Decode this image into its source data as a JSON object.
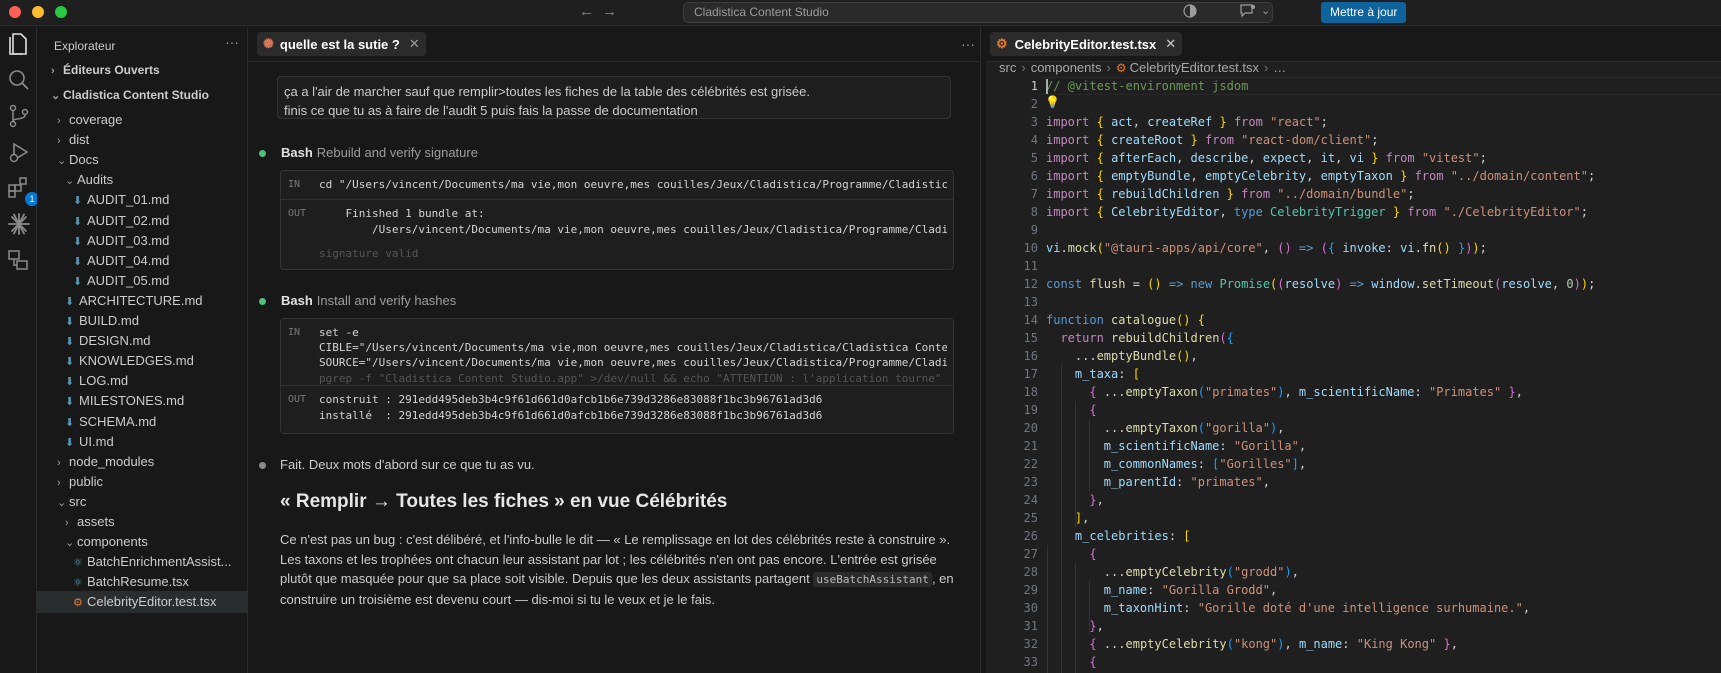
{
  "titlebar": {
    "command_center": "Cladistica Content Studio",
    "update_button": "Mettre à jour"
  },
  "activity_badge": "1",
  "explorer": {
    "title": "Explorateur",
    "open_editors": "Éditeurs Ouverts",
    "project": "Cladistica Content Studio",
    "items": [
      {
        "label": "coverage",
        "kind": "folder",
        "depth": 1,
        "expanded": false
      },
      {
        "label": "dist",
        "kind": "folder",
        "depth": 1,
        "expanded": false
      },
      {
        "label": "Docs",
        "kind": "folder",
        "depth": 1,
        "expanded": true
      },
      {
        "label": "Audits",
        "kind": "folder",
        "depth": 2,
        "expanded": true
      },
      {
        "label": "AUDIT_01.md",
        "kind": "md",
        "depth": 3
      },
      {
        "label": "AUDIT_02.md",
        "kind": "md",
        "depth": 3
      },
      {
        "label": "AUDIT_03.md",
        "kind": "md",
        "depth": 3
      },
      {
        "label": "AUDIT_04.md",
        "kind": "md",
        "depth": 3
      },
      {
        "label": "AUDIT_05.md",
        "kind": "md",
        "depth": 3
      },
      {
        "label": "ARCHITECTURE.md",
        "kind": "md",
        "depth": 2
      },
      {
        "label": "BUILD.md",
        "kind": "md",
        "depth": 2
      },
      {
        "label": "DESIGN.md",
        "kind": "md",
        "depth": 2
      },
      {
        "label": "KNOWLEDGES.md",
        "kind": "md",
        "depth": 2
      },
      {
        "label": "LOG.md",
        "kind": "md",
        "depth": 2
      },
      {
        "label": "MILESTONES.md",
        "kind": "md",
        "depth": 2
      },
      {
        "label": "SCHEMA.md",
        "kind": "md",
        "depth": 2
      },
      {
        "label": "UI.md",
        "kind": "md",
        "depth": 2
      },
      {
        "label": "node_modules",
        "kind": "folder",
        "depth": 1,
        "expanded": false
      },
      {
        "label": "public",
        "kind": "folder",
        "depth": 1,
        "expanded": false
      },
      {
        "label": "src",
        "kind": "folder",
        "depth": 1,
        "expanded": true
      },
      {
        "label": "assets",
        "kind": "folder",
        "depth": 2,
        "expanded": false
      },
      {
        "label": "components",
        "kind": "folder",
        "depth": 2,
        "expanded": true
      },
      {
        "label": "BatchEnrichmentAssist...",
        "kind": "tsx",
        "depth": 3
      },
      {
        "label": "BatchResume.tsx",
        "kind": "tsx",
        "depth": 3
      },
      {
        "label": "CelebrityEditor.test.tsx",
        "kind": "tsx-test",
        "depth": 3,
        "active": true
      }
    ]
  },
  "chat": {
    "tab_label": "quelle est la sutie ?",
    "user_message_line1": "ça a l'air de marcher sauf que remplir>toutes les fiches de la table des célébrités est grisée.",
    "user_message_line2": "finis ce que tu as à faire de l'audit 5 puis fais la passe de documentation",
    "step1": {
      "tool": "Bash",
      "desc": "Rebuild and verify signature",
      "in_label": "IN",
      "in_code": "cd \"/Users/vincent/Documents/ma vie,mon oeuvre,mes couilles/Jeux/Cladistica/Programme/Cladistica Content Studio\"",
      "out_label": "OUT",
      "out_line1": "    Finished 1 bundle at:",
      "out_line2": "        /Users/vincent/Documents/ma vie,mon oeuvre,mes couilles/Jeux/Cladistica/Programme/Cladistica Content Studio",
      "out_line3": "signature valid"
    },
    "step2": {
      "tool": "Bash",
      "desc": "Install and verify hashes",
      "in_label": "IN",
      "in_line1": "set -e",
      "in_line2": "CIBLE=\"/Users/vincent/Documents/ma vie,mon oeuvre,mes couilles/Jeux/Cladistica/Cladistica Content Studio\"",
      "in_line3": "SOURCE=\"/Users/vincent/Documents/ma vie,mon oeuvre,mes couilles/Jeux/Cladistica/Programme/Cladistica Content Studio\"",
      "in_line4": "pgrep -f \"Cladistica Content Studio.app\" >/dev/null && echo \"ATTENTION : l'application tourne\" || true",
      "out_label": "OUT",
      "out_line1": "construit : 291edd495deb3b4c9f61d661d0afcb1b6e739d3286e83088f1bc3b96761ad3d6",
      "out_line2": "installé  : 291edd495deb3b4c9f61d661d0afcb1b6e739d3286e83088f1bc3b96761ad3d6"
    },
    "answer_intro": "Fait. Deux mots d'abord sur ce que tu as vu.",
    "answer_heading": "« Remplir → Toutes les fiches » en vue Célébrités",
    "answer_para_1": "Ce n'est pas un bug : c'est délibéré, et l'info-bulle le dit — « Le remplissage en lot des célébrités reste à construire ». Les taxons et les trophées ont chacun leur assistant par lot ; les célébrités n'en ont pas encore. L'entrée est grisée plutôt que masquée pour que sa place soit visible. Depuis que les deux assistants partagent ",
    "answer_code": "useBatchAssistant",
    "answer_para_2": ", en construire un troisième est devenu court — dis-moi si tu le veux et je le fais."
  },
  "editor": {
    "tab_label": "CelebrityEditor.test.tsx",
    "breadcrumb": [
      "src",
      "components",
      "CelebrityEditor.test.tsx",
      "…"
    ],
    "line_numbers": [
      "1",
      "2",
      "3",
      "4",
      "5",
      "6",
      "7",
      "8",
      "9",
      "10",
      "11",
      "12",
      "13",
      "14",
      "15",
      "16",
      "17",
      "18",
      "19",
      "20",
      "21",
      "22",
      "23",
      "24",
      "25",
      "26",
      "27",
      "28",
      "29",
      "30",
      "31",
      "32",
      "33"
    ]
  }
}
